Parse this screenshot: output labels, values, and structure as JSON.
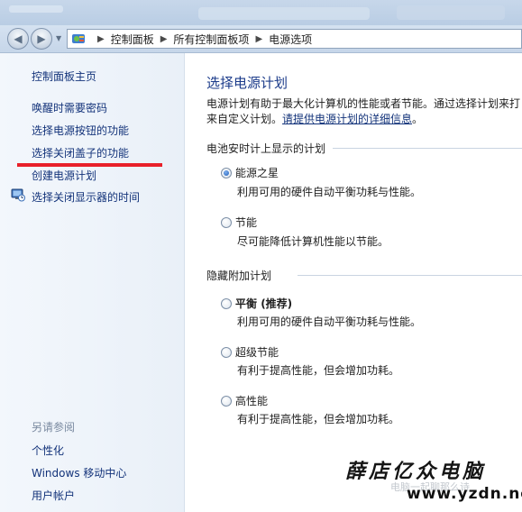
{
  "addressbar": {
    "crumbs": [
      "控制面板",
      "所有控制面板项",
      "电源选项"
    ]
  },
  "sidebar": {
    "home": "控制面板主页",
    "links": [
      "唤醒时需要密码",
      "选择电源按钮的功能",
      "选择关闭盖子的功能",
      "创建电源计划",
      "选择关闭显示器的时间"
    ],
    "highlight_color": "#e8202a",
    "see_also": {
      "title": "另请参阅",
      "links": [
        "个性化",
        "Windows 移动中心",
        "用户帐户"
      ]
    }
  },
  "main": {
    "heading": "选择电源计划",
    "description_line1": "电源计划有助于最大化计算机的性能或者节能。通过选择计划来打",
    "description_line2_prefix": "来自定义计划。",
    "description_link": "请提供电源计划的详细信息",
    "description_line2_suffix": "。",
    "section_battery": "电池安时计上显示的计划",
    "section_hidden": "隐藏附加计划",
    "plans": [
      {
        "name": "能源之星",
        "desc": "利用可用的硬件自动平衡功耗与性能。",
        "selected": true
      },
      {
        "name": "节能",
        "desc": "尽可能降低计算机性能以节能。",
        "selected": false
      },
      {
        "name": "平衡",
        "name_suffix": " (推荐)",
        "desc": "利用可用的硬件自动平衡功耗与性能。",
        "selected": false
      },
      {
        "name": "超级节能",
        "desc": "有利于提高性能，但会增加功耗。",
        "selected": false
      },
      {
        "name": "高性能",
        "desc": "有利于提高性能，但会增加功耗。",
        "selected": false
      }
    ]
  },
  "watermark": {
    "title": "薛店亿众电脑",
    "url": "www.yzdn.net",
    "faint": "电脑一起聊那么诗"
  },
  "icons": {
    "back": "back-arrow-icon",
    "forward": "forward-arrow-icon",
    "control_panel": "control-panel-icon",
    "monitor": "monitor-clock-icon"
  }
}
